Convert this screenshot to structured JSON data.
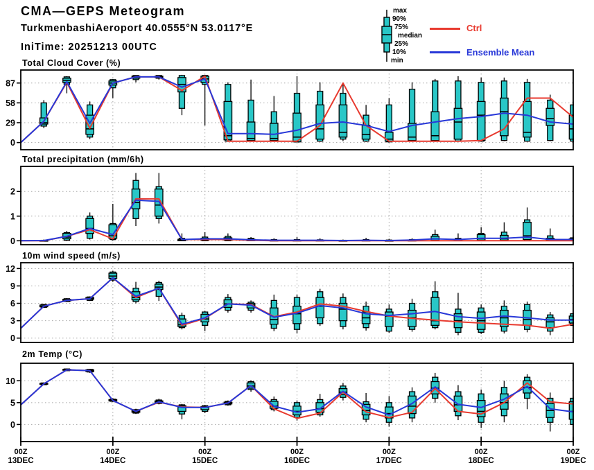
{
  "header": {
    "title": "CMA—GEPS Meteogram",
    "location": "TurkmenbashiAeroport 40.0555°N 53.0117°E",
    "initime": "IniTime: 20251213 00UTC"
  },
  "legend": {
    "box_labels": [
      "max",
      "90%",
      "75%",
      "median",
      "25%",
      "10%",
      "min"
    ],
    "ctrl_label": "Ctrl",
    "mean_label": "Ensemble Mean"
  },
  "colors": {
    "ctrl": "#e83a2f",
    "mean": "#2838d8",
    "box_fill": "#29c7c7",
    "box_edge": "#000000",
    "grid": "#a6a6a6",
    "frame": "#000000"
  },
  "x_axis": {
    "hours_step": 6,
    "n_points": 25,
    "day_labels": [
      [
        "00Z",
        "13DEC"
      ],
      [
        "00Z",
        "14DEC"
      ],
      [
        "00Z",
        "15DEC"
      ],
      [
        "00Z",
        "16DEC"
      ],
      [
        "00Z",
        "17DEC"
      ],
      [
        "00Z",
        "18DEC"
      ],
      [
        "00Z",
        "19DEC"
      ]
    ]
  },
  "chart_data": [
    {
      "type": "box+line",
      "id": "total-cloud-cover",
      "title": "Total Cloud Cover (%)",
      "ylabel": "%",
      "ylim": [
        -10.5,
        106
      ],
      "yticks": [
        0,
        29,
        58,
        87
      ],
      "boxes": [
        null,
        [
          21,
          24,
          27,
          29,
          36,
          58,
          62
        ],
        [
          72,
          85,
          88,
          91,
          94,
          96,
          97
        ],
        [
          5,
          8,
          12,
          20,
          40,
          55,
          60
        ],
        [
          65,
          80,
          84,
          87,
          90,
          92,
          93
        ],
        [
          88,
          92,
          94,
          96,
          97,
          98,
          98
        ],
        [
          92,
          94,
          95,
          96,
          97,
          98,
          98
        ],
        [
          40,
          50,
          74,
          85,
          95,
          98,
          99
        ],
        [
          25,
          85,
          88,
          93,
          97,
          98,
          99
        ],
        [
          1,
          2,
          4,
          10,
          60,
          85,
          88
        ],
        [
          1,
          2,
          3,
          6,
          30,
          62,
          92
        ],
        [
          1,
          2,
          3,
          6,
          28,
          45,
          68
        ],
        [
          0,
          1,
          1,
          8,
          43,
          72,
          97
        ],
        [
          1,
          2,
          5,
          20,
          55,
          75,
          88
        ],
        [
          2,
          5,
          8,
          15,
          55,
          72,
          87
        ],
        [
          1,
          2,
          5,
          12,
          25,
          40,
          55
        ],
        [
          0,
          1,
          2,
          5,
          15,
          55,
          65
        ],
        [
          1,
          2,
          3,
          8,
          28,
          78,
          88
        ],
        [
          1,
          2,
          3,
          10,
          45,
          90,
          93
        ],
        [
          1,
          2,
          5,
          30,
          50,
          90,
          97
        ],
        [
          1,
          2,
          3,
          40,
          60,
          88,
          95
        ],
        [
          2,
          3,
          10,
          45,
          65,
          90,
          95
        ],
        [
          1,
          2,
          8,
          15,
          60,
          88,
          93
        ],
        [
          2,
          3,
          25,
          35,
          50,
          62,
          70
        ],
        [
          1,
          2,
          5,
          20,
          40,
          55,
          60
        ]
      ],
      "series": [
        {
          "name": "Ctrl",
          "values": [
            0,
            31,
            88,
            21,
            87,
            96,
            96,
            76,
            97,
            2,
            2,
            2,
            2,
            25,
            87,
            25,
            2,
            2,
            2,
            2,
            3,
            20,
            65,
            65,
            37
          ]
        },
        {
          "name": "Ensemble Mean",
          "values": [
            0,
            31,
            89,
            28,
            87,
            96,
            96,
            81,
            93,
            13,
            13,
            12,
            18,
            28,
            30,
            25,
            16,
            25,
            30,
            35,
            38,
            43,
            40,
            30,
            27
          ]
        }
      ]
    },
    {
      "type": "box+line",
      "id": "total-precipitation",
      "title": "Total precipitation (mm/6h)",
      "ylabel": "mm/6h",
      "ylim": [
        -0.16,
        3.02
      ],
      "yticks": [
        0,
        1,
        2
      ],
      "boxes": [
        null,
        [
          0,
          0,
          0,
          0,
          0.01,
          0.02,
          0.05
        ],
        [
          0,
          0.02,
          0.08,
          0.15,
          0.3,
          0.33,
          0.4
        ],
        [
          0.05,
          0.1,
          0.3,
          0.5,
          0.9,
          1.0,
          1.15
        ],
        [
          0,
          0.05,
          0.1,
          0.2,
          0.65,
          0.7,
          1.5
        ],
        [
          0.6,
          0.9,
          1.3,
          1.55,
          2.1,
          2.45,
          2.75
        ],
        [
          0.7,
          0.9,
          1.0,
          1.45,
          2.1,
          2.2,
          2.75
        ],
        [
          0,
          0,
          0,
          0.02,
          0.06,
          0.1,
          0.3
        ],
        [
          0,
          0,
          0.02,
          0.05,
          0.1,
          0.15,
          0.35
        ],
        [
          0,
          0,
          0.02,
          0.05,
          0.12,
          0.18,
          0.3
        ],
        [
          0,
          0,
          0,
          0.02,
          0.06,
          0.1,
          0.15
        ],
        [
          0,
          0,
          0,
          0,
          0.02,
          0.05,
          0.1
        ],
        [
          0,
          0,
          0,
          0,
          0.02,
          0.05,
          0.15
        ],
        [
          0,
          0,
          0,
          0,
          0.02,
          0.04,
          0.1
        ],
        [
          0,
          0,
          0,
          0,
          0.01,
          0.02,
          0.05
        ],
        [
          0,
          0,
          0,
          0,
          0.02,
          0.05,
          0.12
        ],
        [
          0,
          0,
          0,
          0,
          0.01,
          0.03,
          0.08
        ],
        [
          0,
          0,
          0,
          0,
          0.02,
          0.05,
          0.1
        ],
        [
          0,
          0,
          0.02,
          0.08,
          0.18,
          0.25,
          0.45
        ],
        [
          0,
          0,
          0,
          0.02,
          0.06,
          0.1,
          0.3
        ],
        [
          0,
          0,
          0.02,
          0.08,
          0.25,
          0.3,
          0.55
        ],
        [
          0,
          0,
          0.02,
          0.08,
          0.22,
          0.35,
          0.75
        ],
        [
          0,
          0,
          0.05,
          0.2,
          0.75,
          0.85,
          1.35
        ],
        [
          0,
          0,
          0,
          0.02,
          0.1,
          0.2,
          0.5
        ],
        [
          0,
          0,
          0,
          0.02,
          0.08,
          0.12,
          0.2
        ]
      ],
      "series": [
        {
          "name": "Ctrl",
          "values": [
            0,
            0,
            0.18,
            0.45,
            0.08,
            1.7,
            1.7,
            0.05,
            0.05,
            0.05,
            0.02,
            0,
            0,
            0,
            0,
            0,
            0,
            0,
            0,
            0,
            0,
            0,
            0,
            0,
            0
          ]
        },
        {
          "name": "Ensemble Mean",
          "values": [
            0,
            0.01,
            0.18,
            0.5,
            0.25,
            1.65,
            1.6,
            0.05,
            0.08,
            0.08,
            0.04,
            0.02,
            0.02,
            0.02,
            0.01,
            0.02,
            0.01,
            0.03,
            0.08,
            0.05,
            0.1,
            0.1,
            0.15,
            0.05,
            0.05
          ]
        }
      ]
    },
    {
      "type": "box+line",
      "id": "wind-speed-10m",
      "title": "10m wind speed (m/s)",
      "ylabel": "m/s",
      "ylim": [
        -0.75,
        13.0
      ],
      "yticks": [
        0,
        3,
        6,
        9,
        12
      ],
      "boxes": [
        null,
        [
          5.2,
          5.3,
          5.4,
          5.5,
          5.7,
          5.8,
          5.9
        ],
        [
          6.2,
          6.3,
          6.4,
          6.5,
          6.7,
          6.8,
          6.9
        ],
        [
          6.4,
          6.5,
          6.7,
          6.8,
          7.0,
          7.1,
          7.2
        ],
        [
          9.7,
          10.0,
          10.3,
          10.7,
          11.2,
          11.4,
          11.6
        ],
        [
          6.0,
          6.3,
          6.6,
          7.0,
          8.0,
          8.6,
          9.7
        ],
        [
          6.4,
          7.2,
          8.4,
          8.8,
          9.3,
          9.6,
          9.9
        ],
        [
          1.5,
          1.8,
          2.0,
          2.3,
          3.3,
          3.9,
          4.4
        ],
        [
          1.2,
          2.2,
          2.8,
          3.3,
          4.1,
          4.5,
          4.7
        ],
        [
          4.4,
          4.8,
          5.3,
          5.9,
          6.6,
          7.0,
          7.6
        ],
        [
          4.4,
          4.8,
          5.2,
          5.7,
          6.0,
          6.2,
          6.5
        ],
        [
          1.2,
          1.7,
          2.4,
          3.2,
          5.2,
          6.5,
          7.5
        ],
        [
          0.8,
          1.5,
          2.5,
          4.2,
          5.5,
          7.0,
          7.5
        ],
        [
          2.1,
          2.5,
          3.5,
          5.5,
          7.0,
          8.0,
          8.5
        ],
        [
          1.5,
          2.0,
          3.0,
          5.0,
          6.0,
          7.0,
          7.7
        ],
        [
          1.3,
          1.8,
          2.5,
          3.5,
          4.5,
          5.5,
          6.3
        ],
        [
          0.9,
          1.2,
          2.0,
          3.8,
          4.5,
          5.0,
          5.8
        ],
        [
          1.1,
          1.5,
          2.0,
          3.5,
          4.8,
          6.0,
          6.8
        ],
        [
          1.5,
          1.8,
          2.2,
          3.0,
          7.0,
          8.0,
          9.8
        ],
        [
          0.5,
          1.0,
          1.8,
          3.0,
          4.2,
          5.0,
          7.8
        ],
        [
          0.7,
          1.0,
          1.5,
          3.0,
          4.5,
          5.2,
          5.8
        ],
        [
          0.8,
          1.2,
          2.0,
          3.5,
          4.8,
          5.5,
          6.5
        ],
        [
          1.0,
          1.5,
          2.2,
          3.2,
          4.8,
          5.8,
          6.3
        ],
        [
          0.5,
          1.2,
          1.8,
          2.8,
          3.5,
          4.0,
          4.5
        ],
        [
          2.0,
          2.2,
          2.6,
          3.2,
          3.8,
          4.2,
          4.4
        ]
      ],
      "series": [
        {
          "name": "Ctrl",
          "values": [
            1.7,
            5.5,
            6.5,
            6.8,
            10.4,
            7.0,
            8.6,
            2.2,
            3.4,
            5.9,
            5.8,
            3.7,
            4.5,
            5.9,
            5.5,
            4.6,
            3.8,
            3.4,
            3.1,
            2.8,
            2.6,
            2.4,
            2.2,
            1.7,
            2.4
          ]
        },
        {
          "name": "Ensemble Mean",
          "values": [
            1.7,
            5.5,
            6.5,
            6.8,
            10.4,
            7.2,
            8.6,
            2.4,
            3.5,
            5.9,
            5.7,
            3.6,
            4.3,
            5.6,
            5.2,
            4.2,
            3.9,
            4.2,
            4.6,
            3.7,
            3.4,
            3.8,
            3.5,
            3.1,
            3.1
          ]
        }
      ]
    },
    {
      "type": "box+line",
      "id": "temp-2m",
      "title": "2m Temp (°C)",
      "ylabel": "°C",
      "ylim": [
        -3.9,
        14.0
      ],
      "yticks": [
        0,
        5,
        10
      ],
      "boxes": [
        null,
        [
          9.0,
          9.1,
          9.2,
          9.3,
          9.4,
          9.5,
          9.6
        ],
        [
          12.2,
          12.3,
          12.4,
          12.5,
          12.6,
          12.7,
          12.8
        ],
        [
          11.8,
          12.0,
          12.1,
          12.3,
          12.5,
          12.6,
          12.7
        ],
        [
          5.1,
          5.3,
          5.4,
          5.5,
          5.7,
          5.8,
          6.0
        ],
        [
          2.4,
          2.6,
          2.8,
          3.0,
          3.2,
          3.4,
          3.6
        ],
        [
          4.6,
          4.8,
          5.0,
          5.2,
          5.4,
          5.6,
          5.9
        ],
        [
          1.2,
          2.4,
          3.0,
          4.0,
          4.3,
          4.5,
          4.7
        ],
        [
          2.6,
          3.0,
          3.4,
          3.9,
          4.1,
          4.3,
          4.5
        ],
        [
          4.3,
          4.5,
          4.7,
          4.9,
          5.1,
          5.3,
          5.5
        ],
        [
          7.5,
          8.0,
          8.3,
          8.8,
          9.5,
          9.8,
          10.1
        ],
        [
          3.0,
          3.4,
          3.7,
          4.2,
          5.3,
          5.7,
          6.4
        ],
        [
          0.9,
          1.6,
          2.2,
          3.0,
          4.2,
          5.0,
          5.5
        ],
        [
          1.8,
          2.2,
          2.8,
          3.6,
          5.0,
          5.7,
          7.0
        ],
        [
          5.5,
          6.2,
          6.8,
          7.4,
          8.2,
          8.8,
          9.5
        ],
        [
          0.5,
          1.2,
          2.2,
          3.2,
          4.6,
          5.2,
          7.2
        ],
        [
          -0.5,
          0.5,
          1.5,
          2.5,
          4.0,
          5.0,
          6.5
        ],
        [
          0.5,
          1.5,
          2.5,
          4.2,
          6.5,
          7.5,
          8.5
        ],
        [
          5.0,
          6.0,
          7.0,
          8.3,
          9.8,
          10.8,
          11.8
        ],
        [
          1.0,
          2.0,
          3.0,
          4.5,
          6.5,
          7.5,
          9.0
        ],
        [
          -0.8,
          0.5,
          1.8,
          3.0,
          5.5,
          7.0,
          8.0
        ],
        [
          0.5,
          2.0,
          3.5,
          5.0,
          7.0,
          8.5,
          10.0
        ],
        [
          3.5,
          6.0,
          7.2,
          8.5,
          10.0,
          10.8,
          11.5
        ],
        [
          -1.6,
          0.5,
          1.6,
          3.2,
          4.8,
          6.0,
          7.3
        ],
        [
          -1.2,
          0.0,
          1.2,
          3.0,
          5.2,
          6.0,
          6.3
        ]
      ],
      "series": [
        {
          "name": "Ctrl",
          "values": [
            4.5,
            9.3,
            12.5,
            12.3,
            5.5,
            3.0,
            5.1,
            4.0,
            3.9,
            4.9,
            8.9,
            3.6,
            1.4,
            2.6,
            7.4,
            2.9,
            1.6,
            2.8,
            8.2,
            3.0,
            2.4,
            5.0,
            9.5,
            5.2,
            4.7
          ]
        },
        {
          "name": "Ensemble Mean",
          "values": [
            4.5,
            9.3,
            12.5,
            12.3,
            5.5,
            3.0,
            5.2,
            3.9,
            3.9,
            4.9,
            8.9,
            4.2,
            2.8,
            3.6,
            7.6,
            4.0,
            2.2,
            4.8,
            8.6,
            4.6,
            3.9,
            5.8,
            8.7,
            3.6,
            2.9
          ]
        }
      ]
    }
  ]
}
